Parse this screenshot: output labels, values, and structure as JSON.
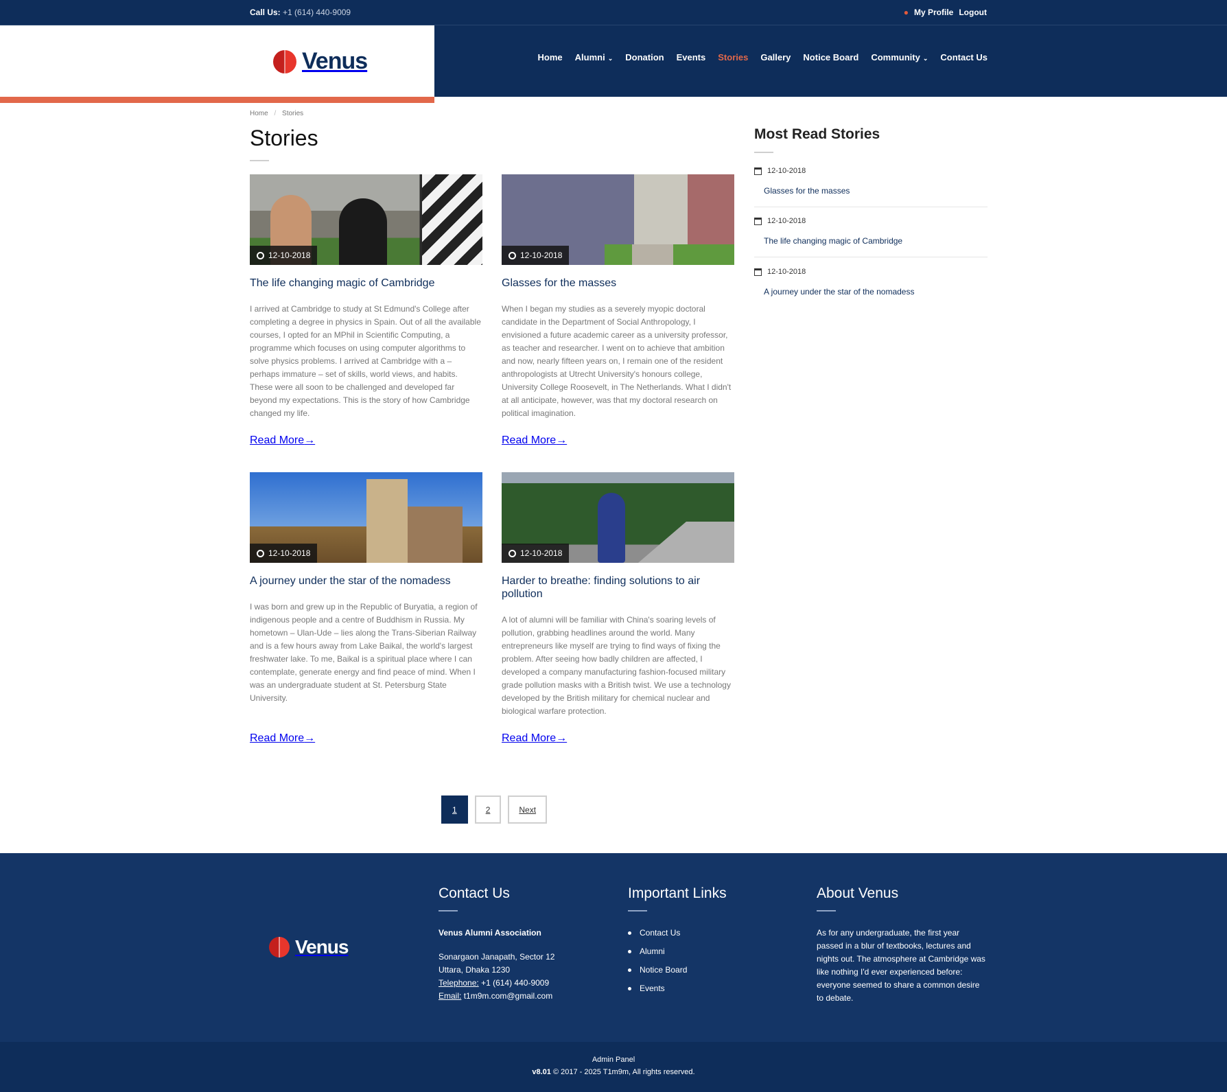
{
  "topbar": {
    "call_label": "Call Us:",
    "phone": "+1 (614) 440-9009",
    "profile": "My Profile",
    "logout": "Logout",
    "icon": "user-icon"
  },
  "logo": {
    "text": "Venus"
  },
  "nav": [
    {
      "label": "Home"
    },
    {
      "label": "Alumni",
      "caret": "⌄"
    },
    {
      "label": "Donation"
    },
    {
      "label": "Events"
    },
    {
      "label": "Stories",
      "active": true
    },
    {
      "label": "Gallery"
    },
    {
      "label": "Notice Board"
    },
    {
      "label": "Community",
      "caret": "⌄"
    },
    {
      "label": "Contact Us"
    }
  ],
  "breadcrumb": {
    "home": "Home",
    "current": "Stories",
    "sep": "/"
  },
  "page_title": "Stories",
  "stories": [
    {
      "date": "12-10-2018",
      "title": "The life changing magic of Cambridge",
      "excerpt": "I arrived at Cambridge to study at St Edmund's College after completing a degree in physics in Spain. Out of all the available courses, I opted for an MPhil in Scientific Computing, a programme which focuses on using computer algorithms to solve physics problems. I arrived at Cambridge with a – perhaps immature – set of skills, world views, and habits. These were all soon to be challenged and developed far beyond my expectations. This is the story of how Cambridge changed my life.",
      "read_more": "Read More"
    },
    {
      "date": "12-10-2018",
      "title": "Glasses for the masses",
      "excerpt": "When I began my studies as a severely myopic doctoral candidate in the Department of Social Anthropology, I envisioned a future academic career as a university professor, as teacher and researcher. I went on to achieve that ambition and now, nearly fifteen years on, I remain one of the resident anthropologists at Utrecht University's honours college, University College Roosevelt, in The Netherlands. What I didn't at all anticipate, however, was that my doctoral research on political imagination.",
      "read_more": "Read More"
    },
    {
      "date": "12-10-2018",
      "title": "A journey under the star of the nomadess",
      "excerpt": "I was born and grew up in the Republic of Buryatia, a region of indigenous people and a centre of Buddhism in Russia. My hometown – Ulan-Ude – lies along the Trans-Siberian Railway and is a few hours away from Lake Baikal, the world's largest freshwater lake. To me, Baikal is a spiritual place where I can contemplate, generate energy and find peace of mind. When I was an undergraduate student at St. Petersburg State University.",
      "read_more": "Read More"
    },
    {
      "date": "12-10-2018",
      "title": "Harder to breathe: finding solutions to air pollution",
      "excerpt": "A lot of alumni will be familiar with China's soaring levels of pollution, grabbing headlines around the world. Many entrepreneurs like myself are trying to find ways of fixing the problem. After seeing how badly children are affected, I developed a company manufacturing fashion-focused military grade pollution masks with a British twist. We use a technology developed by the British military for chemical nuclear and biological warfare protection.",
      "read_more": "Read More"
    }
  ],
  "sidebar": {
    "title": "Most Read Stories",
    "items": [
      {
        "date": "12-10-2018",
        "title": "Glasses for the masses"
      },
      {
        "date": "12-10-2018",
        "title": "The life changing magic of Cambridge"
      },
      {
        "date": "12-10-2018",
        "title": "A journey under the star of the nomadess"
      }
    ]
  },
  "pagination": {
    "pages": [
      "1",
      "2"
    ],
    "active": "1",
    "next": "Next"
  },
  "footer": {
    "logo": "Venus",
    "contact": {
      "title": "Contact Us",
      "org": "Venus Alumni Association",
      "address1": "Sonargaon Janapath, Sector 12",
      "address2": "Uttara, Dhaka 1230",
      "tel_label": "Telephone:",
      "tel": "+1 (614) 440-9009",
      "email_label": "Email:",
      "email": "t1m9m.com@gmail.com"
    },
    "links": {
      "title": "Important Links",
      "items": [
        "Contact Us",
        "Alumni",
        "Notice Board",
        "Events"
      ]
    },
    "about": {
      "title": "About Venus",
      "text": "As for any undergraduate, the first year passed in a blur of textbooks, lectures and nights out. The atmosphere at Cambridge was like nothing I'd ever experienced before: everyone seemed to share a common desire to debate."
    },
    "admin": "Admin Panel",
    "version": "v8.01",
    "copyright": "© 2017 - 2025 T1m9m, All rights reserved."
  },
  "colors": {
    "navy": "#0e2d5a",
    "accent": "#e2684a"
  }
}
